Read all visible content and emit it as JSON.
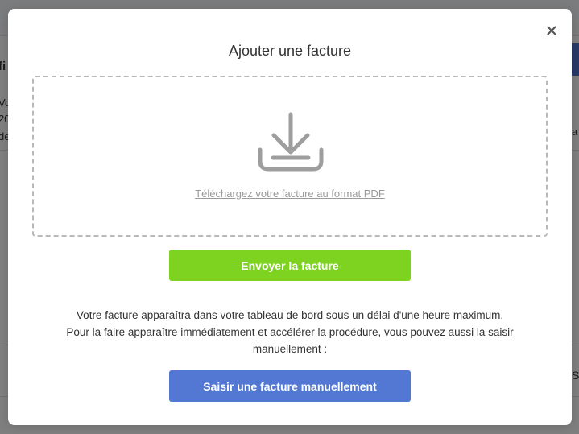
{
  "background": {
    "fragments": [
      "fi",
      "Vo",
      "20",
      "de",
      "a",
      "S"
    ]
  },
  "modal": {
    "title": "Ajouter une facture",
    "close_icon": "close-icon",
    "dropzone": {
      "icon": "download-icon",
      "link_text": "Téléchargez votre facture au format PDF"
    },
    "send_button": "Envoyer la facture",
    "info_lines": [
      "Votre facture apparaîtra dans votre tableau de bord sous un délai d'une heure maximum.",
      "Pour la faire apparaître immédiatement et accélérer la procédure, vous pouvez aussi la saisir manuellement :"
    ],
    "manual_button": "Saisir une facture manuellement"
  },
  "colors": {
    "send_button": "#7ed321",
    "manual_button": "#5278d4",
    "dropzone_border": "#b9b9b9",
    "overlay": "rgba(0,0,0,0.5)"
  }
}
